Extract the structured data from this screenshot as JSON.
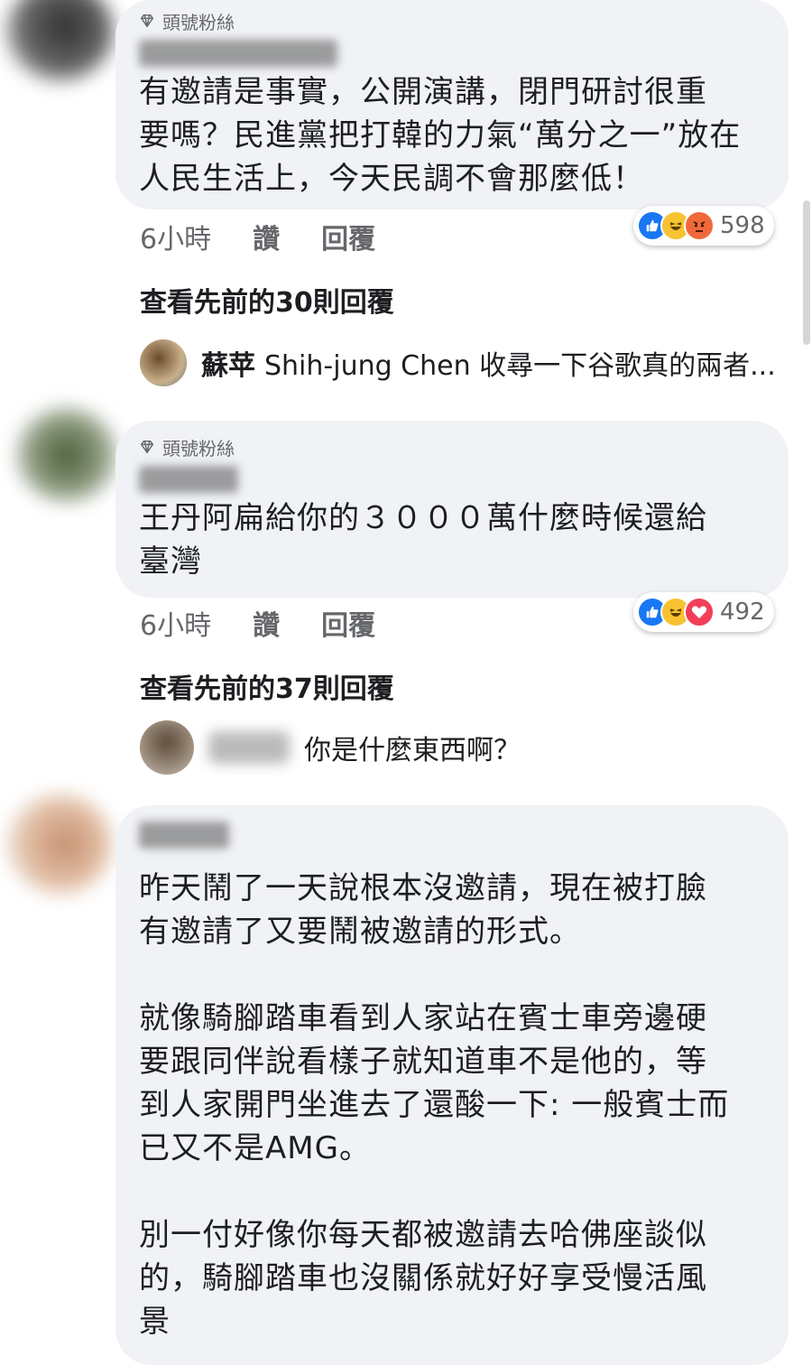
{
  "comments": [
    {
      "badge": "頭號粉絲",
      "text": "有邀請是事實，公開演講，閉門研討很重\n要嗎？民進黨把打韓的力氣“萬分之一”放在\n人民生活上，今天民調不會那麼低！",
      "time": "6小時",
      "like_label": "讚",
      "reply_label": "回覆",
      "reactions": [
        "like",
        "haha",
        "angry"
      ],
      "reaction_count": "598",
      "prev_replies": "查看先前的30則回覆",
      "reply": {
        "name": "蘇苹",
        "text": "Shih-jung Chen 收尋一下谷歌真的兩者..."
      }
    },
    {
      "badge": "頭號粉絲",
      "text": "王丹阿扁給你的３０００萬什麼時候還給\n臺灣",
      "time": "6小時",
      "like_label": "讚",
      "reply_label": "回覆",
      "reactions": [
        "like",
        "haha",
        "love"
      ],
      "reaction_count": "492",
      "prev_replies": "查看先前的37則回覆",
      "reply": {
        "name": "",
        "text": "你是什麼東西啊？"
      }
    },
    {
      "text": "昨天鬧了一天說根本沒邀請，現在被打臉\n有邀請了又要鬧被邀請的形式。\n\n就像騎腳踏車看到人家站在賓士車旁邊硬\n要跟同伴說看樣子就知道車不是他的，等\n到人家開門坐進去了還酸一下: 一般賓士而\n已又不是AMG。\n\n別一付好像你每天都被邀請去哈佛座談似\n的，騎腳踏車也沒關係就好好享受慢活風\n景"
    }
  ]
}
